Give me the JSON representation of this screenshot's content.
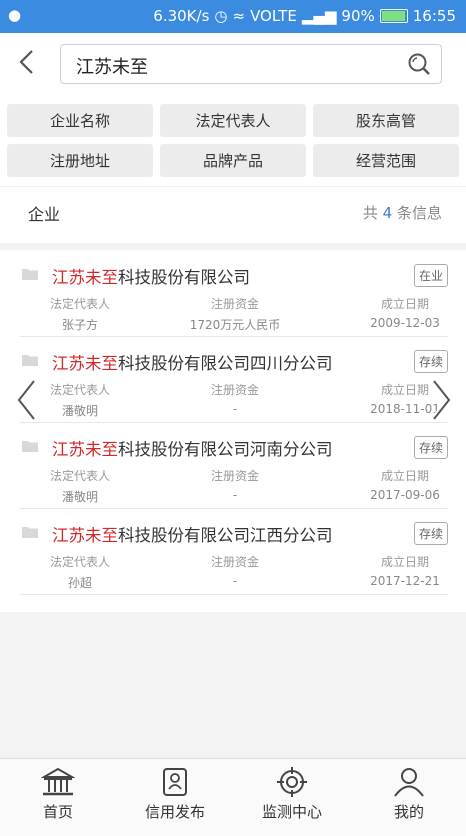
{
  "status_bar": {
    "speed": "6.30K/s",
    "network": "VOLTE",
    "battery": "90%",
    "time": "16:55"
  },
  "search": {
    "value": "江苏未至"
  },
  "filters": [
    "企业名称",
    "法定代表人",
    "股东高管",
    "注册地址",
    "品牌产品",
    "经营范围"
  ],
  "result_header": {
    "category": "企业",
    "count_prefix": "共",
    "count": "4",
    "count_suffix": "条信息"
  },
  "columns": {
    "rep": "法定代表人",
    "capital": "注册资金",
    "date": "成立日期"
  },
  "companies": [
    {
      "highlight": "江苏未至",
      "name_rest": "科技股份有限公司",
      "status": "在业",
      "rep": "张子方",
      "capital": "1720万元人民币",
      "date": "2009-12-03"
    },
    {
      "highlight": "江苏未至",
      "name_rest": "科技股份有限公司四川分公司",
      "status": "存续",
      "rep": "潘敬明",
      "capital": "-",
      "date": "2018-11-01"
    },
    {
      "highlight": "江苏未至",
      "name_rest": "科技股份有限公司河南分公司",
      "status": "存续",
      "rep": "潘敬明",
      "capital": "-",
      "date": "2017-09-06"
    },
    {
      "highlight": "江苏未至",
      "name_rest": "科技股份有限公司江西分公司",
      "status": "存续",
      "rep": "孙超",
      "capital": "-",
      "date": "2017-12-21"
    }
  ],
  "tabs": [
    "首页",
    "信用发布",
    "监测中心",
    "我的"
  ],
  "colors": {
    "status_bar": "#3b8be0",
    "highlight": "#d0292b",
    "count": "#3b7dd8"
  }
}
